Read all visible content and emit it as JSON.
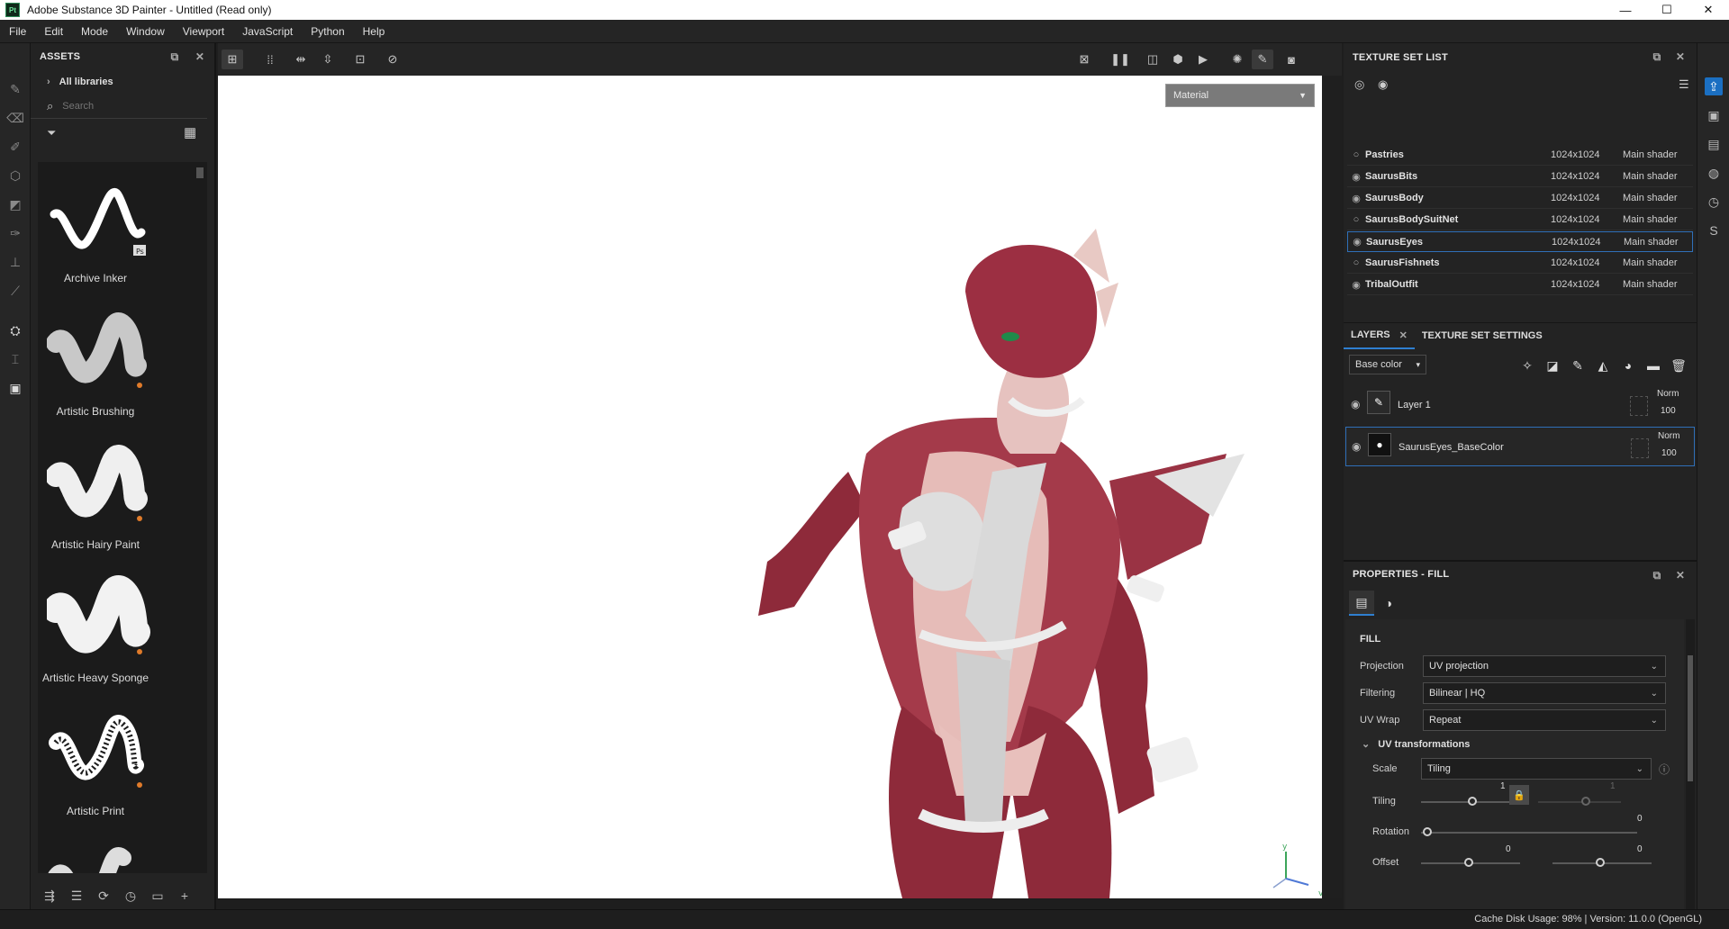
{
  "window": {
    "title": "Adobe Substance 3D Painter - Untitled (Read only)",
    "logo_text": "Pt",
    "minimize": "—",
    "maximize": "☐",
    "close": "✕"
  },
  "menu": [
    "File",
    "Edit",
    "Mode",
    "Window",
    "Viewport",
    "JavaScript",
    "Python",
    "Help"
  ],
  "assets": {
    "title": "ASSETS",
    "library": "All libraries",
    "search_placeholder": "Search",
    "brushes": [
      {
        "name": "Archive Inker",
        "badge": "Ps"
      },
      {
        "name": "Artistic Brushing",
        "badge": ""
      },
      {
        "name": "Artistic Hairy Paint",
        "badge": ""
      },
      {
        "name": "Artistic Heavy Sponge",
        "badge": ""
      },
      {
        "name": "Artistic Print",
        "badge": ""
      }
    ]
  },
  "viewport": {
    "material_mode": "Material",
    "gizmo_y": "y",
    "gizmo_v": "v"
  },
  "texture_set_list": {
    "title": "TEXTURE SET LIST",
    "rows": [
      {
        "name": "Pastries",
        "resolution": "1024x1024",
        "shader": "Main shader",
        "selected": false
      },
      {
        "name": "SaurusBits",
        "resolution": "1024x1024",
        "shader": "Main shader",
        "selected": false
      },
      {
        "name": "SaurusBody",
        "resolution": "1024x1024",
        "shader": "Main shader",
        "selected": false
      },
      {
        "name": "SaurusBodySuitNet",
        "resolution": "1024x1024",
        "shader": "Main shader",
        "selected": false
      },
      {
        "name": "SaurusEyes",
        "resolution": "1024x1024",
        "shader": "Main shader",
        "selected": true
      },
      {
        "name": "SaurusFishnets",
        "resolution": "1024x1024",
        "shader": "Main shader",
        "selected": false
      },
      {
        "name": "TribalOutfit",
        "resolution": "1024x1024",
        "shader": "Main shader",
        "selected": false
      }
    ]
  },
  "layers": {
    "tab_layers": "LAYERS",
    "tab_tss": "TEXTURE SET SETTINGS",
    "channel": "Base color",
    "items": [
      {
        "name": "Layer 1",
        "blend": "Norm",
        "opacity": "100",
        "selected": false
      },
      {
        "name": "SaurusEyes_BaseColor",
        "blend": "Norm",
        "opacity": "100",
        "selected": true
      }
    ]
  },
  "properties": {
    "title": "PROPERTIES - FILL",
    "section": "FILL",
    "projection_label": "Projection",
    "projection_value": "UV projection",
    "filtering_label": "Filtering",
    "filtering_value": "Bilinear | HQ",
    "uvwrap_label": "UV Wrap",
    "uvwrap_value": "Repeat",
    "uvt_title": "UV transformations",
    "scale_label": "Scale",
    "scale_value": "Tiling",
    "tiling_label": "Tiling",
    "tiling_value": "1",
    "tiling_value2": "1",
    "rotation_label": "Rotation",
    "rotation_value": "0",
    "offset_label": "Offset",
    "offset_x": "0",
    "offset_y": "0"
  },
  "status": {
    "text": "Cache Disk Usage:   98% | Version: 11.0.0 (OpenGL)"
  },
  "colors": {
    "accent": "#2f7fd0",
    "skin_red": "#8e2a3a",
    "skin_pale": "#e8c2c0"
  }
}
